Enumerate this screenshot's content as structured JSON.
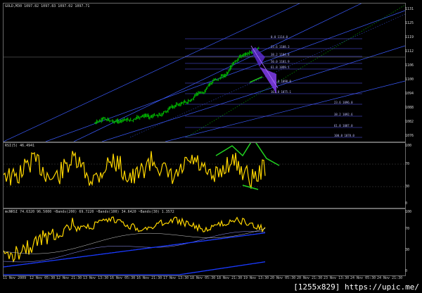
{
  "main_panel": {
    "title": "GOLD,M30  1097.82 1097.83 1097.02 1097.71",
    "price_scale": [
      "1131",
      "1125",
      "1119",
      "1112",
      "1106",
      "1100",
      "1094",
      "1088",
      "1082",
      "1076"
    ],
    "fib_labels": [
      "0.0  1114.0",
      "23.6  1108.3",
      "38.2  1104.8",
      "50.0  1101.9",
      "61.8  1099.1",
      "100.0  1090.0",
      "161.8  1075.1",
      "23.6  1096.0",
      "38.2  1092.6",
      "61.8  1087.0",
      "100.0  1078.0"
    ]
  },
  "rsi_panel": {
    "title": "RSI(5) 46.4941",
    "scale": [
      "100",
      "70",
      "30",
      "0"
    ]
  },
  "ind3_panel": {
    "title": "mcNRSI 74.6320 96.5000  ~Bands(200) 69.7220  ~Bands(100) 34.6420  ~Bands(30) 1.3572",
    "scale": [
      "100",
      "70",
      "30",
      "0"
    ]
  },
  "time_axis": [
    "11 Nov 2009",
    "12 Nov 05:30",
    "12 Nov 21:30",
    "13 Nov 13:30",
    "16 Nov 05:30",
    "16 Nov 21:30",
    "17 Nov 13:30",
    "18 Nov 05:30",
    "18 Nov 21:30",
    "19 Nov 13:30",
    "20 Nov 05:30",
    "20 Nov 21:30",
    "23 Nov 13:30",
    "24 Nov 05:30",
    "24 Nov 21:30"
  ],
  "watermark": "[1255x829] https://upic.me/",
  "colors": {
    "candle": "#00c000",
    "rsi_line": "#ffd700",
    "trend": "#3b5bff",
    "guide": "#00b000",
    "annot": "#21d421",
    "fib": "#8a8aff"
  }
}
